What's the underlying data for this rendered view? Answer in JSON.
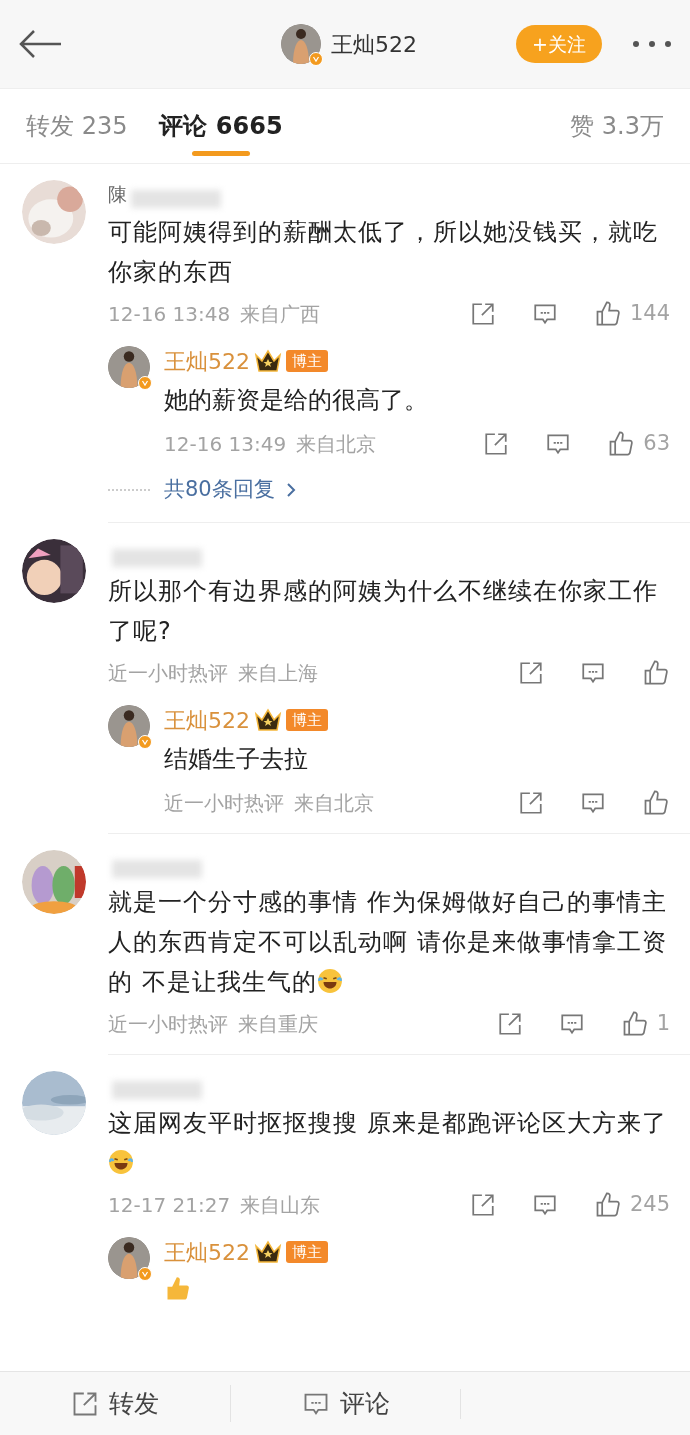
{
  "header": {
    "title": "王灿522",
    "follow_button": "+关注"
  },
  "tabs": [
    {
      "label": "转发 235",
      "selected": false
    },
    {
      "label": "评论 6665",
      "selected": true
    }
  ],
  "likes_total": "赞 3.3万",
  "comments": [
    {
      "name": "陳",
      "text": "可能阿姨得到的薪酬太低了，所以她没钱买，就吃你家的东西",
      "time": "12-16 13:48",
      "location": "来自广西",
      "likes": "144",
      "replies": [
        {
          "name": "王灿522",
          "badge": "博主",
          "text": "她的薪资是给的很高了。",
          "time": "12-16 13:49",
          "location": "来自北京",
          "likes": "63"
        }
      ],
      "more_replies": "共80条回复"
    },
    {
      "text": "所以那个有边界感的阿姨为什么不继续在你家工作了呢?",
      "time": "近一小时热评",
      "location": "来自上海",
      "replies": [
        {
          "name": "王灿522",
          "badge": "博主",
          "text": "结婚生子去拉",
          "time": "近一小时热评",
          "location": "来自北京"
        }
      ]
    },
    {
      "text": "就是一个分寸感的事情 作为保姆做好自己的事情主人的东西肯定不可以乱动啊 请你是来做事情拿工资的 不是让我生气的",
      "emoji": {
        "kind": "laugh"
      },
      "time": "近一小时热评",
      "location": "来自重庆",
      "likes": "1"
    },
    {
      "text": "这届网友平时抠抠搜搜  原来是都跑评论区大方来了",
      "emoji": {
        "kind": "laugh"
      },
      "time": "12-17 21:27",
      "location": "来自山东",
      "likes": "245",
      "replies": [
        {
          "name": "王灿522",
          "badge": "博主",
          "emoji": {
            "kind": "thumb"
          }
        }
      ]
    }
  ],
  "bottom_bar": [
    {
      "label": "转发",
      "kind": "share"
    },
    {
      "label": "评论",
      "kind": "comment"
    }
  ]
}
